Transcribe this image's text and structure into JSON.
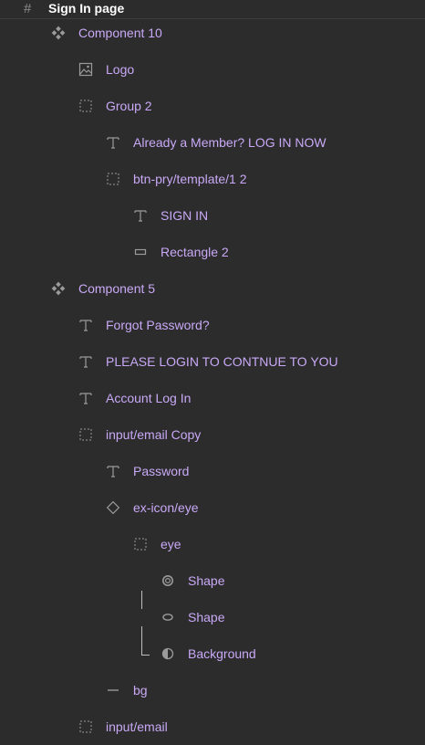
{
  "frame": {
    "icon": "frame-hash-icon",
    "title": "Sign In page"
  },
  "layers": [
    {
      "label": "Component 10",
      "icon": "component-icon"
    },
    {
      "label": "Logo",
      "icon": "image-icon"
    },
    {
      "label": "Group 2",
      "icon": "group-icon"
    },
    {
      "label": "Already a Member? LOG IN NOW",
      "icon": "text-icon"
    },
    {
      "label": "btn-pry/template/1 2",
      "icon": "group-icon"
    },
    {
      "label": "SIGN IN",
      "icon": "text-icon"
    },
    {
      "label": "Rectangle 2",
      "icon": "rectangle-icon"
    },
    {
      "label": "Component 5",
      "icon": "component-icon"
    },
    {
      "label": "Forgot Password?",
      "icon": "text-icon"
    },
    {
      "label": "PLEASE LOGIN TO CONTNUE TO YOU",
      "icon": "text-icon"
    },
    {
      "label": "Account Log In",
      "icon": "text-icon"
    },
    {
      "label": "input/email Copy",
      "icon": "group-icon"
    },
    {
      "label": "Password",
      "icon": "text-icon"
    },
    {
      "label": "ex-icon/eye",
      "icon": "instance-diamond-icon"
    },
    {
      "label": "eye",
      "icon": "group-icon"
    },
    {
      "label": "Shape",
      "icon": "ellipse-ring-icon"
    },
    {
      "label": "Shape",
      "icon": "ellipse-icon"
    },
    {
      "label": "Background",
      "icon": "half-circle-icon"
    },
    {
      "label": "bg",
      "icon": "line-icon"
    },
    {
      "label": "input/email",
      "icon": "group-icon"
    }
  ],
  "colors": {
    "panel_bg": "#2c2c2c",
    "layer_text": "#c9a9f7",
    "icon_gray": "#9a9a9a",
    "title_text": "#ffffff"
  }
}
